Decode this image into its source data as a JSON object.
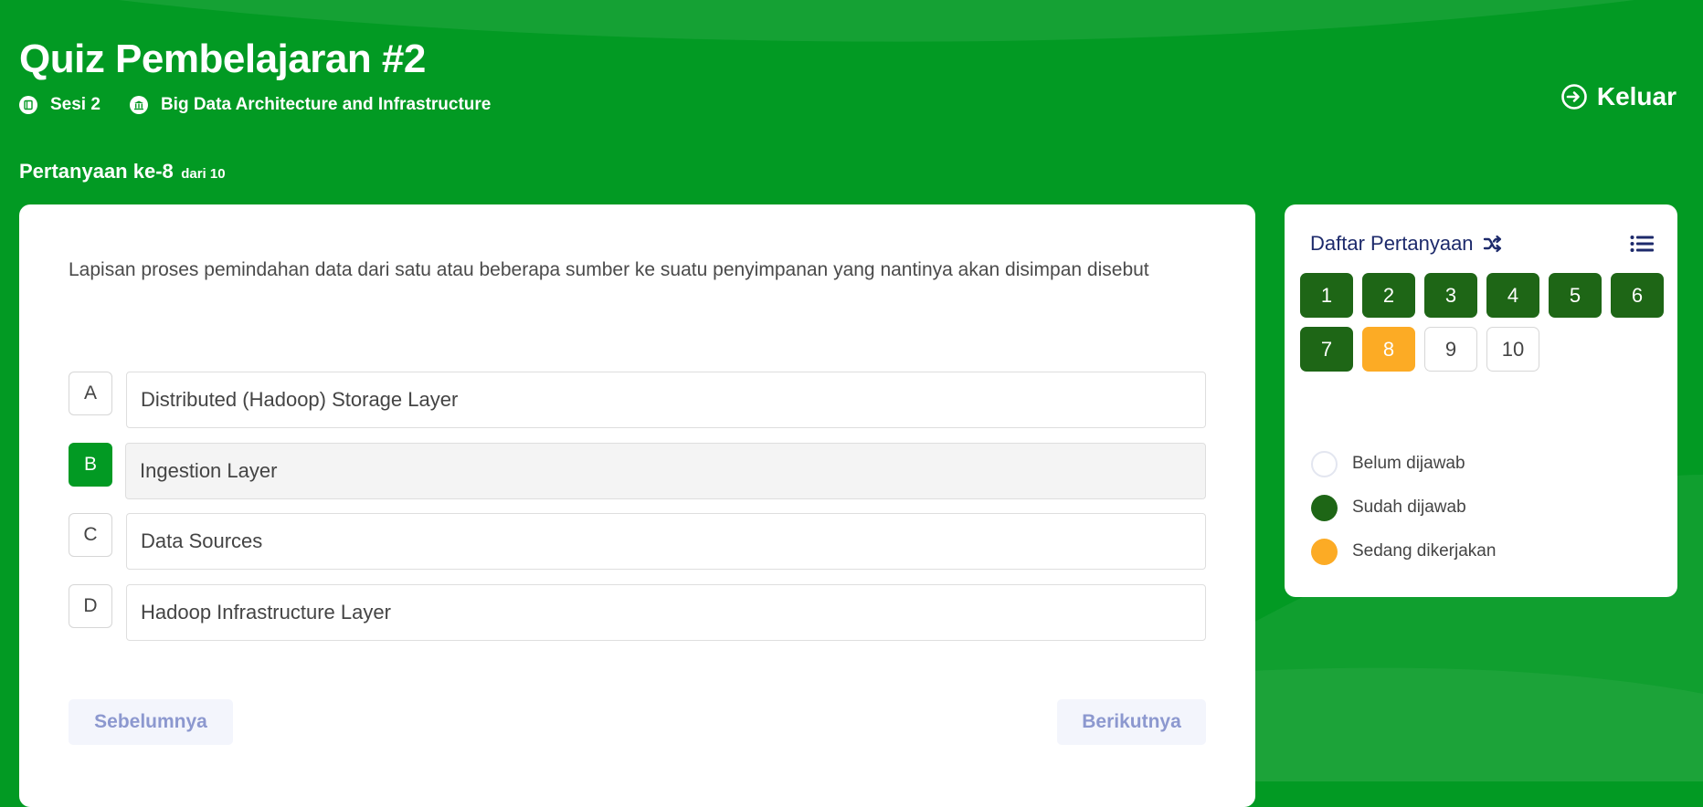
{
  "quiz": {
    "title": "Quiz Pembelajaran #2",
    "session": "Sesi 2",
    "course": "Big Data Architecture and Infrastructure",
    "logout_label": "Keluar"
  },
  "progress": {
    "label": "Pertanyaan ke-8",
    "total_label": "dari 10"
  },
  "question": {
    "text": "Lapisan proses pemindahan data dari satu atau beberapa sumber ke suatu penyimpanan yang nantinya akan disimpan disebut",
    "selected": "B",
    "options": [
      {
        "letter": "A",
        "text": "Distributed (Hadoop) Storage Layer"
      },
      {
        "letter": "B",
        "text": "Ingestion Layer"
      },
      {
        "letter": "C",
        "text": "Data Sources"
      },
      {
        "letter": "D",
        "text": "Hadoop Infrastructure Layer"
      }
    ]
  },
  "nav": {
    "prev_label": "Sebelumnya",
    "next_label": "Berikutnya"
  },
  "sidebar": {
    "title": "Daftar Pertanyaan",
    "questions": [
      {
        "number": "1",
        "status": "answered"
      },
      {
        "number": "2",
        "status": "answered"
      },
      {
        "number": "3",
        "status": "answered"
      },
      {
        "number": "4",
        "status": "answered"
      },
      {
        "number": "5",
        "status": "answered"
      },
      {
        "number": "6",
        "status": "answered"
      },
      {
        "number": "7",
        "status": "answered"
      },
      {
        "number": "8",
        "status": "current"
      },
      {
        "number": "9",
        "status": "unanswered"
      },
      {
        "number": "10",
        "status": "unanswered"
      }
    ],
    "legend": {
      "unanswered": "Belum dijawab",
      "answered": "Sudah dijawab",
      "current": "Sedang dikerjakan"
    }
  },
  "colors": {
    "background": "#029a23",
    "answered": "#1e6616",
    "current": "#fcab25",
    "nav_text": "#8c98cf",
    "sidebar_title": "#1d2a6b"
  },
  "icons": {
    "session": "book-icon",
    "course": "building-icon",
    "logout": "logout-arrow-icon",
    "shuffle": "shuffle-icon",
    "list": "list-icon"
  }
}
